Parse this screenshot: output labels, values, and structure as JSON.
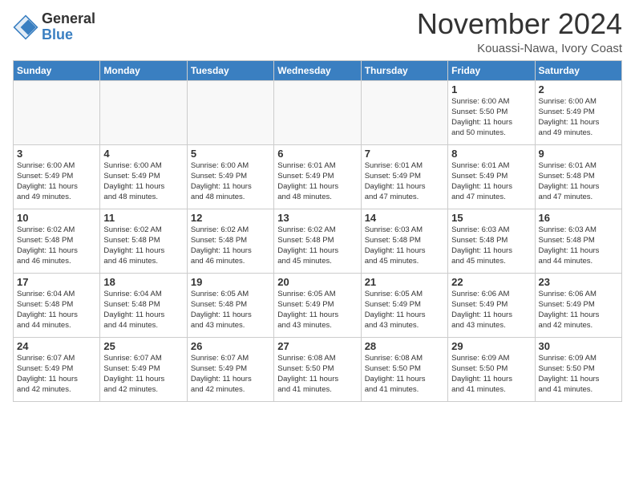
{
  "logo": {
    "general": "General",
    "blue": "Blue"
  },
  "header": {
    "title": "November 2024",
    "location": "Kouassi-Nawa, Ivory Coast"
  },
  "weekdays": [
    "Sunday",
    "Monday",
    "Tuesday",
    "Wednesday",
    "Thursday",
    "Friday",
    "Saturday"
  ],
  "weeks": [
    [
      {
        "day": "",
        "info": ""
      },
      {
        "day": "",
        "info": ""
      },
      {
        "day": "",
        "info": ""
      },
      {
        "day": "",
        "info": ""
      },
      {
        "day": "",
        "info": ""
      },
      {
        "day": "1",
        "info": "Sunrise: 6:00 AM\nSunset: 5:50 PM\nDaylight: 11 hours\nand 50 minutes."
      },
      {
        "day": "2",
        "info": "Sunrise: 6:00 AM\nSunset: 5:49 PM\nDaylight: 11 hours\nand 49 minutes."
      }
    ],
    [
      {
        "day": "3",
        "info": "Sunrise: 6:00 AM\nSunset: 5:49 PM\nDaylight: 11 hours\nand 49 minutes."
      },
      {
        "day": "4",
        "info": "Sunrise: 6:00 AM\nSunset: 5:49 PM\nDaylight: 11 hours\nand 48 minutes."
      },
      {
        "day": "5",
        "info": "Sunrise: 6:00 AM\nSunset: 5:49 PM\nDaylight: 11 hours\nand 48 minutes."
      },
      {
        "day": "6",
        "info": "Sunrise: 6:01 AM\nSunset: 5:49 PM\nDaylight: 11 hours\nand 48 minutes."
      },
      {
        "day": "7",
        "info": "Sunrise: 6:01 AM\nSunset: 5:49 PM\nDaylight: 11 hours\nand 47 minutes."
      },
      {
        "day": "8",
        "info": "Sunrise: 6:01 AM\nSunset: 5:49 PM\nDaylight: 11 hours\nand 47 minutes."
      },
      {
        "day": "9",
        "info": "Sunrise: 6:01 AM\nSunset: 5:48 PM\nDaylight: 11 hours\nand 47 minutes."
      }
    ],
    [
      {
        "day": "10",
        "info": "Sunrise: 6:02 AM\nSunset: 5:48 PM\nDaylight: 11 hours\nand 46 minutes."
      },
      {
        "day": "11",
        "info": "Sunrise: 6:02 AM\nSunset: 5:48 PM\nDaylight: 11 hours\nand 46 minutes."
      },
      {
        "day": "12",
        "info": "Sunrise: 6:02 AM\nSunset: 5:48 PM\nDaylight: 11 hours\nand 46 minutes."
      },
      {
        "day": "13",
        "info": "Sunrise: 6:02 AM\nSunset: 5:48 PM\nDaylight: 11 hours\nand 45 minutes."
      },
      {
        "day": "14",
        "info": "Sunrise: 6:03 AM\nSunset: 5:48 PM\nDaylight: 11 hours\nand 45 minutes."
      },
      {
        "day": "15",
        "info": "Sunrise: 6:03 AM\nSunset: 5:48 PM\nDaylight: 11 hours\nand 45 minutes."
      },
      {
        "day": "16",
        "info": "Sunrise: 6:03 AM\nSunset: 5:48 PM\nDaylight: 11 hours\nand 44 minutes."
      }
    ],
    [
      {
        "day": "17",
        "info": "Sunrise: 6:04 AM\nSunset: 5:48 PM\nDaylight: 11 hours\nand 44 minutes."
      },
      {
        "day": "18",
        "info": "Sunrise: 6:04 AM\nSunset: 5:48 PM\nDaylight: 11 hours\nand 44 minutes."
      },
      {
        "day": "19",
        "info": "Sunrise: 6:05 AM\nSunset: 5:48 PM\nDaylight: 11 hours\nand 43 minutes."
      },
      {
        "day": "20",
        "info": "Sunrise: 6:05 AM\nSunset: 5:49 PM\nDaylight: 11 hours\nand 43 minutes."
      },
      {
        "day": "21",
        "info": "Sunrise: 6:05 AM\nSunset: 5:49 PM\nDaylight: 11 hours\nand 43 minutes."
      },
      {
        "day": "22",
        "info": "Sunrise: 6:06 AM\nSunset: 5:49 PM\nDaylight: 11 hours\nand 43 minutes."
      },
      {
        "day": "23",
        "info": "Sunrise: 6:06 AM\nSunset: 5:49 PM\nDaylight: 11 hours\nand 42 minutes."
      }
    ],
    [
      {
        "day": "24",
        "info": "Sunrise: 6:07 AM\nSunset: 5:49 PM\nDaylight: 11 hours\nand 42 minutes."
      },
      {
        "day": "25",
        "info": "Sunrise: 6:07 AM\nSunset: 5:49 PM\nDaylight: 11 hours\nand 42 minutes."
      },
      {
        "day": "26",
        "info": "Sunrise: 6:07 AM\nSunset: 5:49 PM\nDaylight: 11 hours\nand 42 minutes."
      },
      {
        "day": "27",
        "info": "Sunrise: 6:08 AM\nSunset: 5:50 PM\nDaylight: 11 hours\nand 41 minutes."
      },
      {
        "day": "28",
        "info": "Sunrise: 6:08 AM\nSunset: 5:50 PM\nDaylight: 11 hours\nand 41 minutes."
      },
      {
        "day": "29",
        "info": "Sunrise: 6:09 AM\nSunset: 5:50 PM\nDaylight: 11 hours\nand 41 minutes."
      },
      {
        "day": "30",
        "info": "Sunrise: 6:09 AM\nSunset: 5:50 PM\nDaylight: 11 hours\nand 41 minutes."
      }
    ]
  ]
}
